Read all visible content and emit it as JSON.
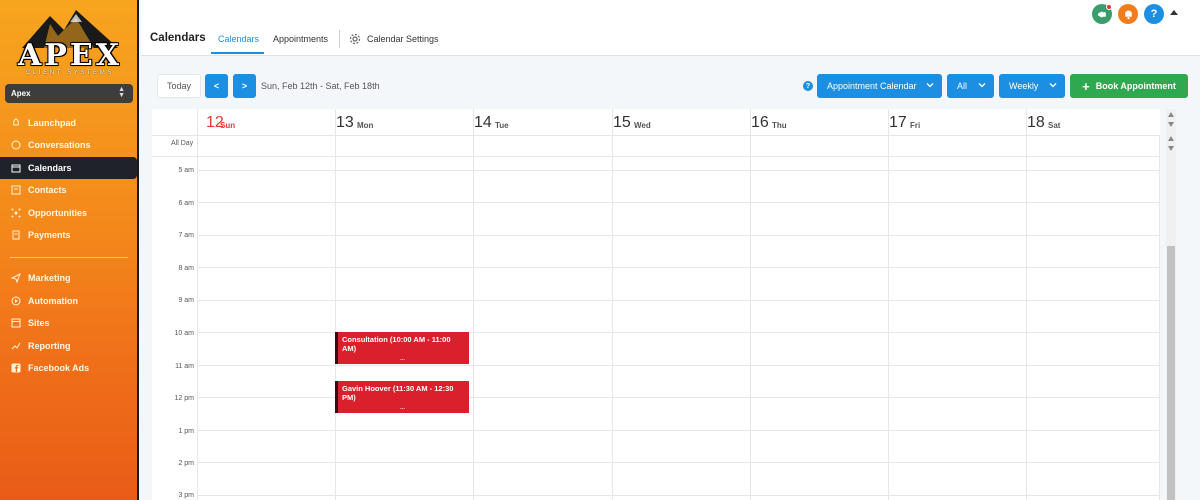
{
  "logo": {
    "word": "APEX",
    "sub": "CLIENT SYSTEMS"
  },
  "account": {
    "name": "Apex"
  },
  "sidebar": {
    "items": [
      {
        "label": "Launchpad",
        "icon": "rocket-icon"
      },
      {
        "label": "Conversations",
        "icon": "chat-icon"
      },
      {
        "label": "Calendars",
        "icon": "calendar-icon",
        "active": true
      },
      {
        "label": "Contacts",
        "icon": "contacts-icon"
      },
      {
        "label": "Opportunities",
        "icon": "opportunities-icon"
      },
      {
        "label": "Payments",
        "icon": "payments-icon"
      },
      {
        "label": "Marketing",
        "icon": "send-icon"
      },
      {
        "label": "Automation",
        "icon": "automation-icon"
      },
      {
        "label": "Sites",
        "icon": "sites-icon"
      },
      {
        "label": "Reporting",
        "icon": "chart-icon"
      },
      {
        "label": "Facebook Ads",
        "icon": "facebook-icon"
      }
    ]
  },
  "header": {
    "title": "Calendars",
    "tabs": [
      {
        "label": "Calendars",
        "active": true
      },
      {
        "label": "Appointments"
      },
      {
        "label": "Calendar Settings",
        "icon": "gear-icon"
      }
    ],
    "icons": [
      {
        "name": "megaphone-icon",
        "color": "#3a9d6b"
      },
      {
        "name": "bell-icon",
        "color": "#f07c1c"
      },
      {
        "name": "help-icon",
        "color": "#1d8fe2",
        "glyph": "?"
      }
    ]
  },
  "toolbar": {
    "today": "Today",
    "prev": "<",
    "next": ">",
    "range": "Sun, Feb 12th - Sat, Feb 18th",
    "calendar_select": "Appointment Calendar",
    "filter_select": "All",
    "view_select": "Weekly",
    "book": "Book Appointment"
  },
  "calendar": {
    "allday_label": "All Day",
    "days": [
      {
        "num": "12",
        "name": "Sun",
        "today": true
      },
      {
        "num": "13",
        "name": "Mon"
      },
      {
        "num": "14",
        "name": "Tue"
      },
      {
        "num": "15",
        "name": "Wed"
      },
      {
        "num": "16",
        "name": "Thu"
      },
      {
        "num": "17",
        "name": "Fri"
      },
      {
        "num": "18",
        "name": "Sat"
      }
    ],
    "hours": [
      "5 am",
      "6 am",
      "7 am",
      "8 am",
      "9 am",
      "10 am",
      "11 am",
      "12 pm",
      "1 pm",
      "2 pm",
      "3 pm"
    ],
    "events": [
      {
        "title": "Consultation (10:00 AM - 11:00 AM)",
        "more": "...",
        "color": "#d9202c"
      },
      {
        "title": "Gavin Hoover (11:30 AM - 12:30 PM)",
        "more": "...",
        "color": "#d9202c"
      }
    ]
  },
  "colors": {
    "accent": "#1d8fe2",
    "success": "#2fa84f",
    "today": "#e53935",
    "event": "#d9202c"
  }
}
